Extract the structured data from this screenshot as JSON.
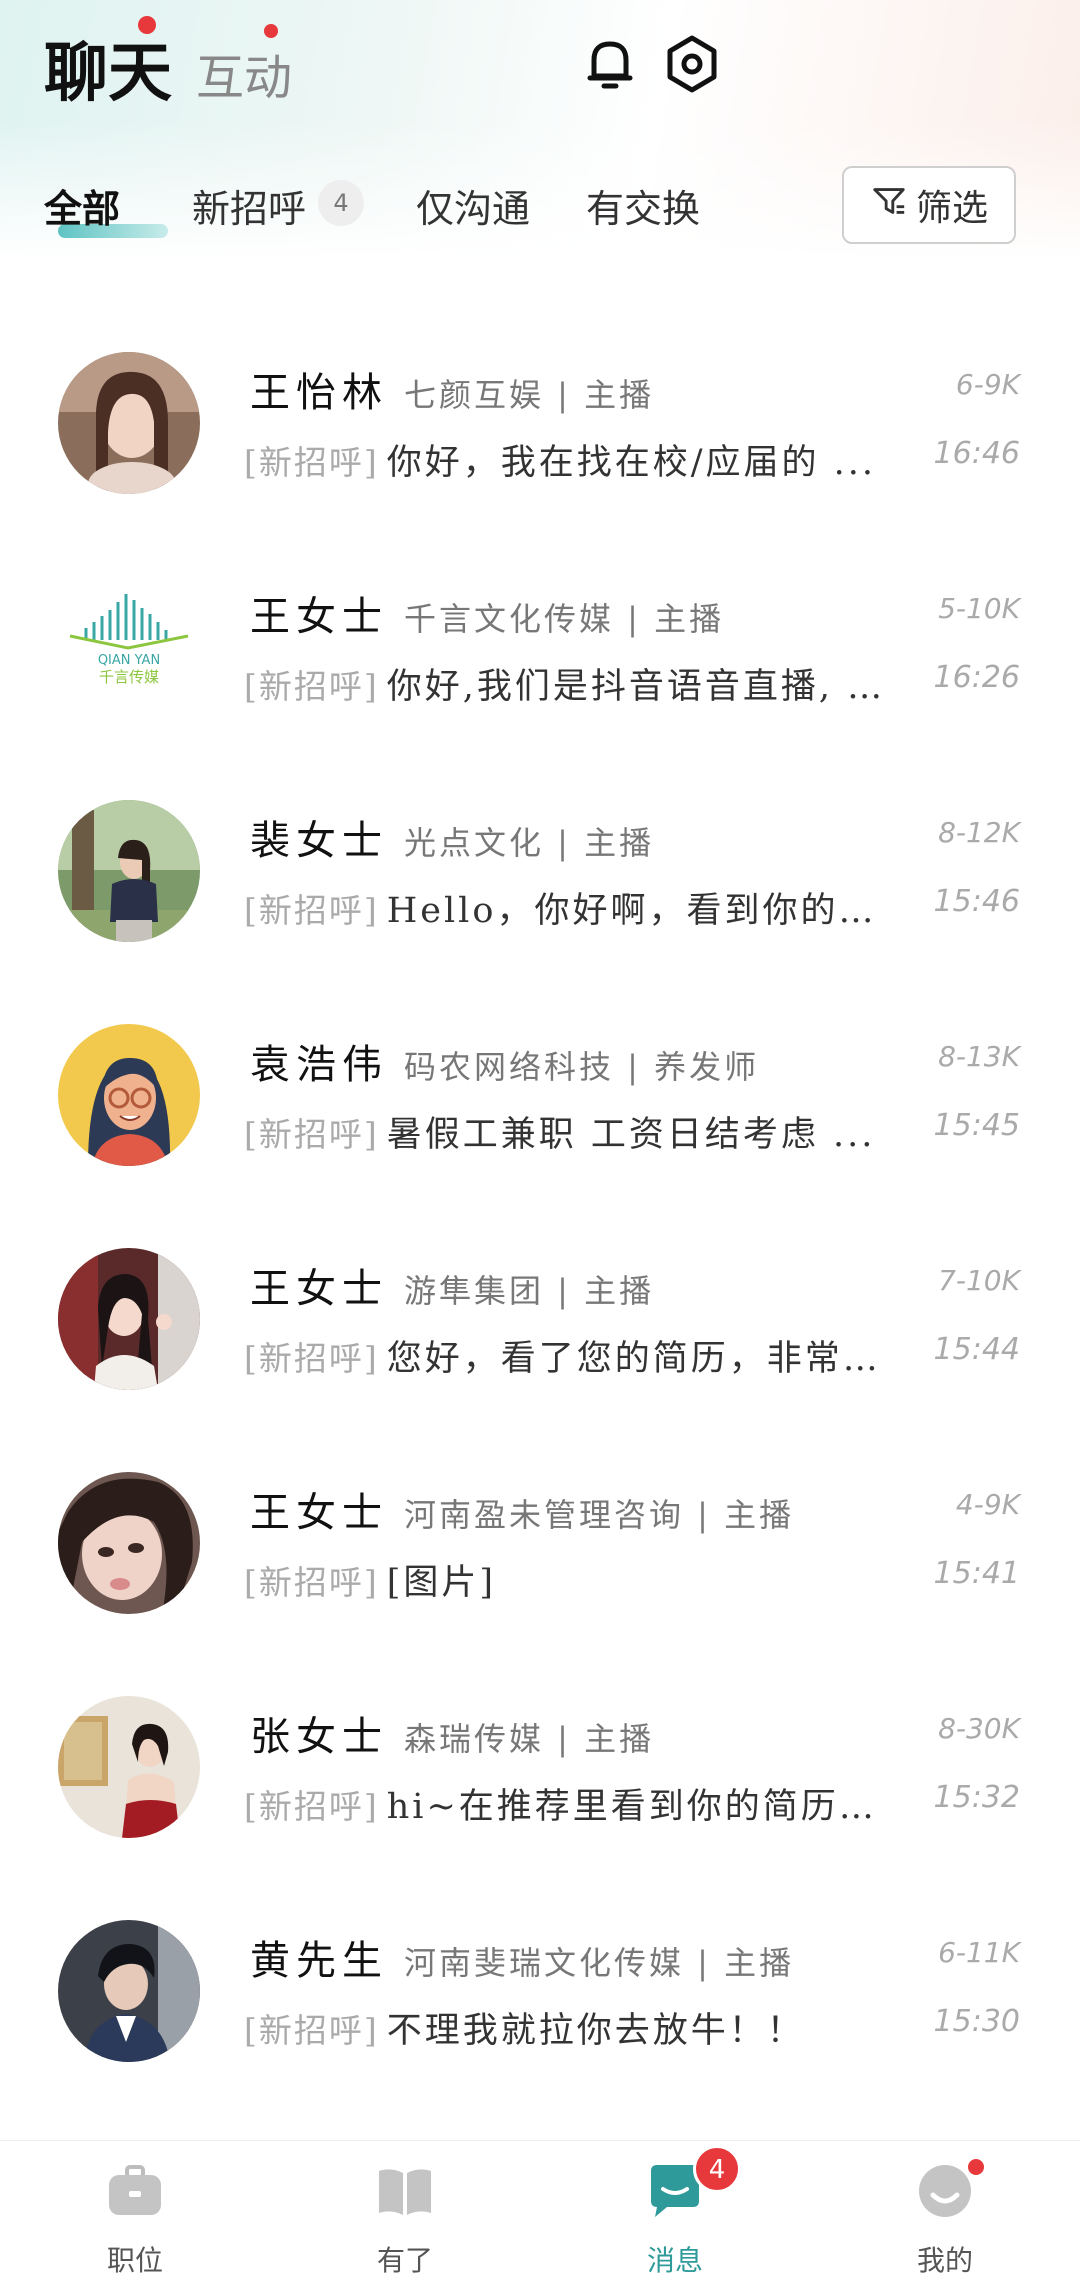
{
  "header": {
    "tabs": [
      {
        "label": "聊天",
        "active": true,
        "dot": true
      },
      {
        "label": "互动",
        "active": false,
        "dot": true
      }
    ],
    "icons": [
      "bell-icon",
      "settings-icon"
    ]
  },
  "filters": {
    "tabs": [
      {
        "label": "全部",
        "active": true
      },
      {
        "label": "新招呼",
        "count": "4"
      },
      {
        "label": "仅沟通"
      },
      {
        "label": "有交换"
      }
    ],
    "filter_button": "筛选"
  },
  "chats": [
    {
      "name": "王怡林",
      "company": "七颜互娱 | 主播",
      "salary": "6-9K",
      "tag": "[新招呼]",
      "message": "你好，我在找在校/应届的 ...",
      "time": "16:46"
    },
    {
      "name": "王女士",
      "company": "千言文化传媒 | 主播",
      "salary": "5-10K",
      "tag": "[新招呼]",
      "message": "你好,我们是抖音语音直播, ...",
      "time": "16:26"
    },
    {
      "name": "裴女士",
      "company": "光点文化 | 主播",
      "salary": "8-12K",
      "tag": "[新招呼]",
      "message": "Hello，你好啊，看到你的简 ...",
      "time": "15:46"
    },
    {
      "name": "袁浩伟",
      "company": "码农网络科技 | 养发师",
      "salary": "8-13K",
      "tag": "[新招呼]",
      "message": "暑假工兼职 工资日结考虑 ...",
      "time": "15:45"
    },
    {
      "name": "王女士",
      "company": "游隼集团 | 主播",
      "salary": "7-10K",
      "tag": "[新招呼]",
      "message": "您好，看了您的简历，非常 ...",
      "time": "15:44"
    },
    {
      "name": "王女士",
      "company": "河南盈未管理咨询 | 主播",
      "salary": "4-9K",
      "tag": "[新招呼]",
      "message": "[图片]",
      "time": "15:41"
    },
    {
      "name": "张女士",
      "company": "森瑞传媒 | 主播",
      "salary": "8-30K",
      "tag": "[新招呼]",
      "message": "hi~在推荐里看到你的简历 ...",
      "time": "15:32"
    },
    {
      "name": "黄先生",
      "company": "河南斐瑞文化传媒 | 主播",
      "salary": "6-11K",
      "tag": "[新招呼]",
      "message": "不理我就拉你去放牛！！",
      "time": "15:30"
    }
  ],
  "avatar_logo_text": "QIAN YAN 千言传媒",
  "bottom_nav": [
    {
      "label": "职位",
      "icon": "briefcase-icon"
    },
    {
      "label": "有了",
      "icon": "book-icon"
    },
    {
      "label": "消息",
      "icon": "chat-icon",
      "active": true,
      "badge": "4"
    },
    {
      "label": "我的",
      "icon": "profile-icon",
      "dot": true
    }
  ],
  "colors": {
    "accent": "#2f9a9a",
    "badge": "#e7383b",
    "muted": "#aaaaaa"
  }
}
